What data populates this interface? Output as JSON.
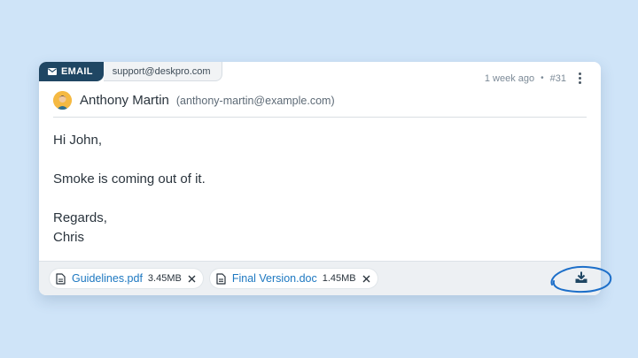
{
  "message": {
    "channel_label": "EMAIL",
    "channel_address": "support@deskpro.com",
    "time_ago": "1 week ago",
    "separator": "•",
    "number": "#31",
    "author_name": "Anthony Martin",
    "author_email": "(anthony-martin@example.com)",
    "body_lines": [
      "Hi John,",
      "Smoke is coming out of it.",
      "Regards,",
      "Chris"
    ]
  },
  "attachments": [
    {
      "name": "Guidelines.pdf",
      "size": "3.45MB"
    },
    {
      "name": "Final Version.doc",
      "size": "1.45MB"
    }
  ],
  "colors": {
    "background": "#cfe4f8",
    "badge": "#1f4663",
    "link": "#1d78c1",
    "annotation": "#1d6fc9"
  },
  "icons": [
    "envelope-icon",
    "more-vertical-icon",
    "file-icon",
    "close-icon",
    "download-icon"
  ]
}
